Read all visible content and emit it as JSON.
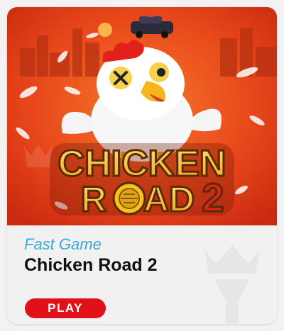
{
  "card": {
    "banner_logo": {
      "line1": "CHICKEN",
      "line2_a": "R",
      "line2_b": "AD",
      "line2_num": "2"
    },
    "category": "Fast Game",
    "title": "Chicken Road 2",
    "play_label": "PLAY"
  },
  "colors": {
    "category": "#3aa9d9",
    "play_button": "#e2101b",
    "banner_bg": "#e8461a",
    "logo_fill": "#f7c11c"
  },
  "icons": [
    "chicken-mascot-illustration",
    "police-car-icon",
    "crown-watermark-icon",
    "manhole-coin-icon"
  ]
}
